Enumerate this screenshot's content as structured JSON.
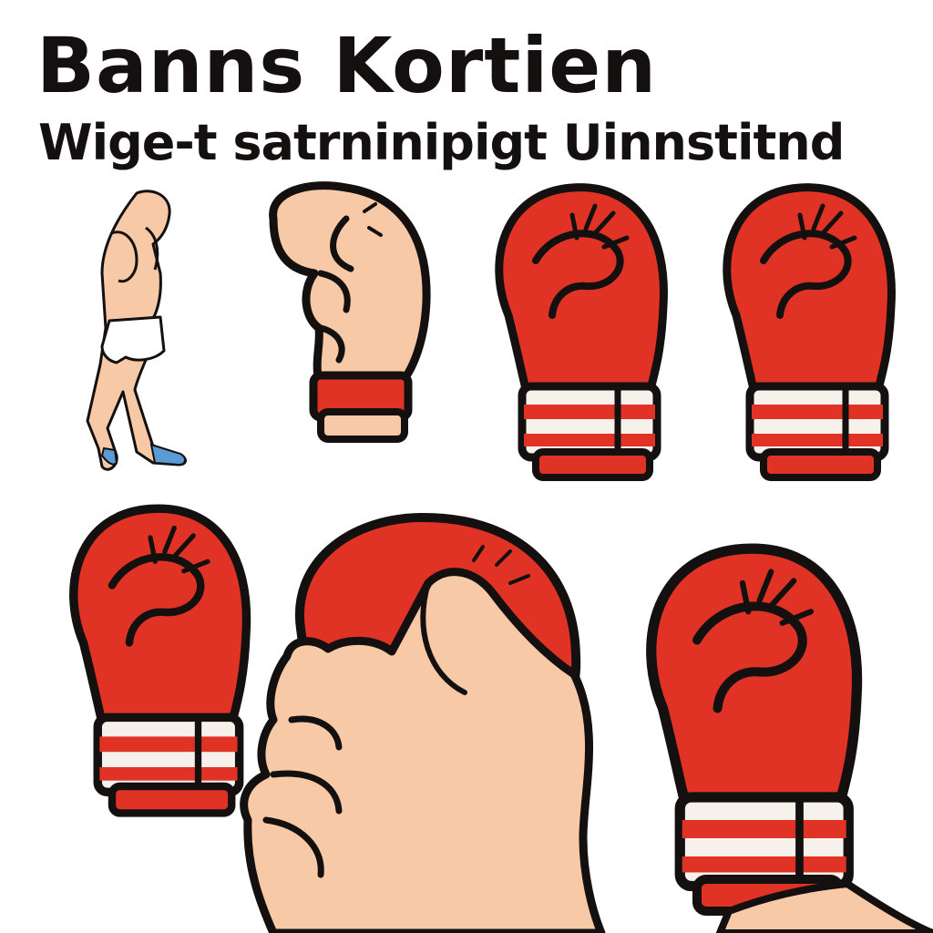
{
  "title": "Banns Kortien",
  "subtitle": "Wige-t satrninipigt Uinnstitnd",
  "colors": {
    "glove_red": "#e13325",
    "skin": "#f7c9a6",
    "outline": "#141010",
    "cuff_white": "#f6f1ea",
    "shoe_blue": "#5b9bd5"
  },
  "illustrations": [
    "boxer-figure",
    "bare-fist",
    "red-boxing-glove",
    "red-boxing-glove",
    "red-boxing-glove",
    "fist-in-glove",
    "red-boxing-glove"
  ]
}
